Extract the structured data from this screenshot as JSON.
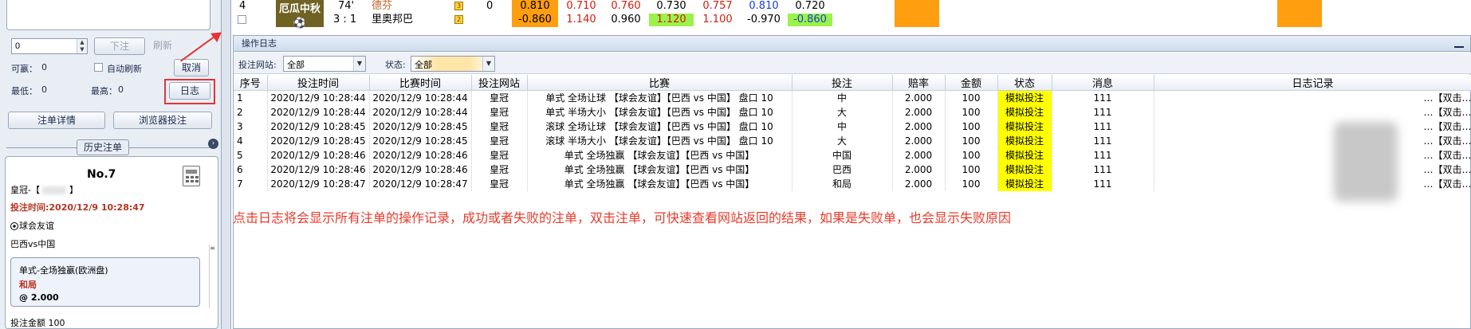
{
  "left_panel": {
    "amount_input": "0",
    "bet_button": "下注",
    "refresh_button": "刷新",
    "available_label": "可嬴：",
    "available_value": "0",
    "auto_refresh_label": "自动刷新",
    "cancel_button": "取消",
    "min_label": "最低：",
    "min_value": "0",
    "max_label": "最高：",
    "max_value": "0",
    "log_button": "日志",
    "order_detail_button": "注单详情",
    "browser_bet_button": "浏览器投注",
    "history_title": "历史注单",
    "card": {
      "no": "No.7",
      "site": "皇冠-【",
      "site_end": "】",
      "bet_time": "投注时间:2020/12/9 10:28:47",
      "league": "球会友谊",
      "match": "巴西vs中国",
      "market": "单式-全场独嬴(欧洲盘)",
      "pick": "和局",
      "odds": "@ 2.000",
      "amount_label": "投注金额",
      "amount_value": "100"
    }
  },
  "top_strip": {
    "row_no": "4",
    "team_a": "厄瓜中秋",
    "minute": "74'",
    "team_b": "德芬",
    "badge1": "3",
    "zero": "0",
    "score": "3 : 1",
    "team_c": "里奥邦巴",
    "badge2": "2",
    "r1": [
      "0.810",
      "0.710",
      "0.760",
      "0.730",
      "0.757",
      "0.810",
      "0.720"
    ],
    "r2": [
      "-0.860",
      "1.140",
      "0.960",
      "1.120",
      "1.100",
      "-0.970",
      "-0.860"
    ]
  },
  "log_window": {
    "title": "操作日志",
    "filter_site_label": "投注网站:",
    "filter_site_value": "全部",
    "filter_status_label": "状态:",
    "filter_status_value": "全部",
    "columns": [
      "序号",
      "投注时间",
      "比赛时间",
      "投注网站",
      "比赛",
      "投注",
      "赔率",
      "金额",
      "状态",
      "消息",
      "日志记录"
    ],
    "rows": [
      {
        "no": "1",
        "bet_time": "2020/12/9 10:28:44",
        "match_time": "2020/12/9 10:28:44",
        "site": "皇冠",
        "match": "单式 全场让球 【球会友谊】【巴西 vs 中国】 盘口 10",
        "pick": "中",
        "odds": "2.000",
        "amount": "100",
        "status": "模拟投注",
        "msg": "111",
        "log": "…【双击…"
      },
      {
        "no": "2",
        "bet_time": "2020/12/9 10:28:44",
        "match_time": "2020/12/9 10:28:44",
        "site": "皇冠",
        "match": "单式 半场大小 【球会友谊】【巴西 vs 中国】 盘口 10",
        "pick": "大",
        "odds": "2.000",
        "amount": "100",
        "status": "模拟投注",
        "msg": "111",
        "log": "…【双击…"
      },
      {
        "no": "3",
        "bet_time": "2020/12/9 10:28:45",
        "match_time": "2020/12/9 10:28:45",
        "site": "皇冠",
        "match": "滚球 全场让球 【球会友谊】【巴西 vs 中国】 盘口 10",
        "pick": "中",
        "odds": "2.000",
        "amount": "100",
        "status": "模拟投注",
        "msg": "111",
        "log": "…【双击…"
      },
      {
        "no": "4",
        "bet_time": "2020/12/9 10:28:45",
        "match_time": "2020/12/9 10:28:45",
        "site": "皇冠",
        "match": "滚球 半场大小 【球会友谊】【巴西 vs 中国】 盘口 10",
        "pick": "大",
        "odds": "2.000",
        "amount": "100",
        "status": "模拟投注",
        "msg": "111",
        "log": "…【双击…"
      },
      {
        "no": "5",
        "bet_time": "2020/12/9 10:28:46",
        "match_time": "2020/12/9 10:28:46",
        "site": "皇冠",
        "match": "单式 全场独赢 【球会友谊】【巴西 vs 中国】",
        "pick": "中国",
        "odds": "2.000",
        "amount": "100",
        "status": "模拟投注",
        "msg": "111",
        "log": "…【双击…"
      },
      {
        "no": "6",
        "bet_time": "2020/12/9 10:28:46",
        "match_time": "2020/12/9 10:28:46",
        "site": "皇冠",
        "match": "单式 全场独赢 【球会友谊】【巴西 vs 中国】",
        "pick": "巴西",
        "odds": "2.000",
        "amount": "100",
        "status": "模拟投注",
        "msg": "111",
        "log": "…【双击…"
      },
      {
        "no": "7",
        "bet_time": "2020/12/9 10:28:47",
        "match_time": "2020/12/9 10:28:47",
        "site": "皇冠",
        "match": "单式 全场独赢 【球会友谊】【巴西 vs 中国】",
        "pick": "和局",
        "odds": "2.000",
        "amount": "100",
        "status": "模拟投注",
        "msg": "111",
        "log": "…【双击…"
      }
    ]
  },
  "annotation": "点击日志将会显示所有注单的操作记录，成功或者失败的注单，双击注单，可快速查看网站返回的结果，如果是失败单，也会显示失败原因",
  "colors": {
    "orange": "#ff9e0f",
    "status_yellow": "#ffff00",
    "annotation_red": "#e83a2a",
    "green": "#9bf24b"
  }
}
